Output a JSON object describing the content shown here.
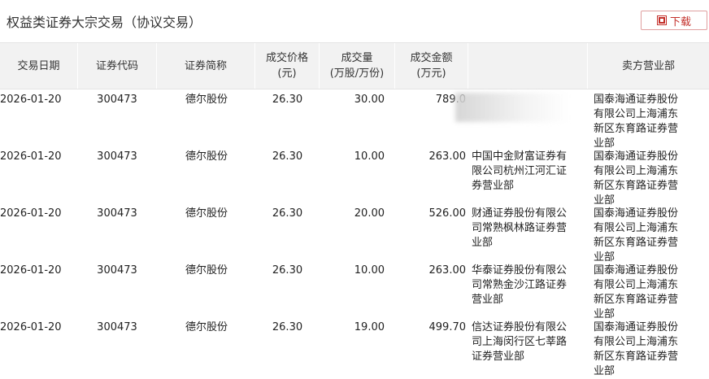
{
  "title": "权益类证券大宗交易（协议交易）",
  "download_label": "下载",
  "headers": {
    "date": "交易日期",
    "code": "证券代码",
    "name": "证券简称",
    "price": "成交价格\n(元)",
    "volume": "成交量\n(万股/万份)",
    "amount": "成交金额\n(万元)",
    "buyer": "",
    "seller": "卖方营业部"
  },
  "rows": [
    {
      "date": "2026-01-20",
      "code": "300473",
      "name": "德尔股份",
      "price": "26.30",
      "volume": "30.00",
      "amount": "789.0",
      "buyer": "",
      "seller": "国泰海通证券股份有限公司上海浦东新区东育路证券营业部"
    },
    {
      "date": "2026-01-20",
      "code": "300473",
      "name": "德尔股份",
      "price": "26.30",
      "volume": "10.00",
      "amount": "263.00",
      "buyer": "中国中金财富证券有限公司杭州江河汇证券营业部",
      "seller": "国泰海通证券股份有限公司上海浦东新区东育路证券营业部"
    },
    {
      "date": "2026-01-20",
      "code": "300473",
      "name": "德尔股份",
      "price": "26.30",
      "volume": "20.00",
      "amount": "526.00",
      "buyer": "财通证券股份有限公司常熟枫林路证券营业部",
      "seller": "国泰海通证券股份有限公司上海浦东新区东育路证券营业部"
    },
    {
      "date": "2026-01-20",
      "code": "300473",
      "name": "德尔股份",
      "price": "26.30",
      "volume": "10.00",
      "amount": "263.00",
      "buyer": "华泰证券股份有限公司常熟金沙江路证券营业部",
      "seller": "国泰海通证券股份有限公司上海浦东新区东育路证券营业部"
    },
    {
      "date": "2026-01-20",
      "code": "300473",
      "name": "德尔股份",
      "price": "26.30",
      "volume": "19.00",
      "amount": "499.70",
      "buyer": "信达证券股份有限公司上海闵行区七莘路证券营业部",
      "seller": "国泰海通证券股份有限公司上海浦东新区东育路证券营业部"
    }
  ]
}
